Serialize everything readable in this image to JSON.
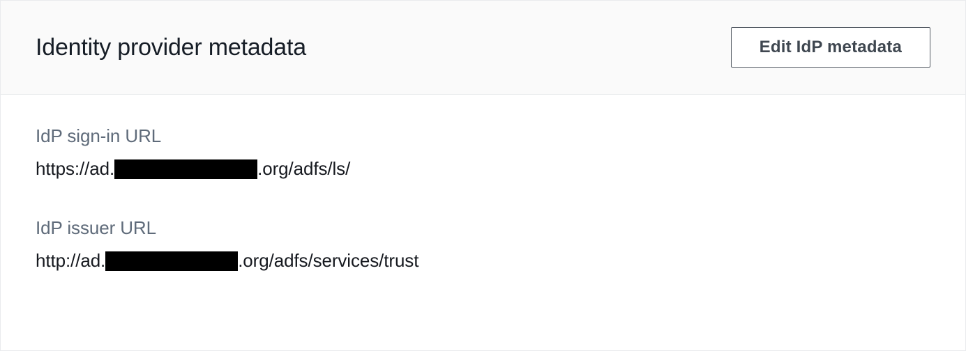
{
  "header": {
    "title": "Identity provider metadata",
    "edit_button_label": "Edit IdP metadata"
  },
  "fields": {
    "signin": {
      "label": "IdP sign-in URL",
      "value_prefix": "https://ad.",
      "value_redacted": true,
      "value_suffix": ".org/adfs/ls/"
    },
    "issuer": {
      "label": "IdP issuer URL",
      "value_prefix": "http://ad.",
      "value_redacted": true,
      "value_suffix": ".org/adfs/services/trust"
    }
  }
}
